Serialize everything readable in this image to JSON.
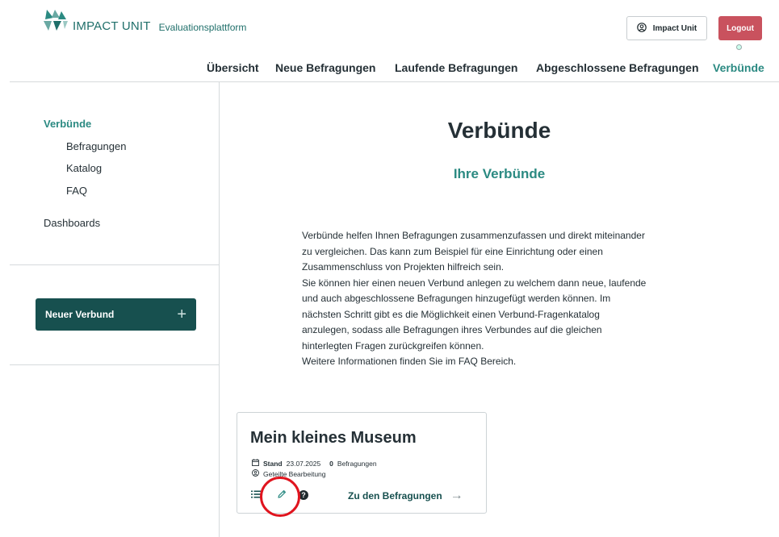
{
  "header": {
    "logo_brand": "IMPACT UNIT",
    "logo_sub": "Evaluationsplattform",
    "user_button": "Impact Unit",
    "logout_button": "Logout"
  },
  "nav": {
    "items": [
      "Übersicht",
      "Neue Befragungen",
      "Laufende Befragungen",
      "Abgeschlossene Befragungen",
      "Verbünde"
    ],
    "active": "Verbünde"
  },
  "sidebar": {
    "section": "Verbünde",
    "items": [
      "Befragungen",
      "Katalog",
      "FAQ"
    ],
    "dashboards": "Dashboards",
    "new_button": "Neuer Verbund",
    "new_button_icon": "plus-icon"
  },
  "main": {
    "title": "Verbünde",
    "subtitle": "Ihre Verbünde",
    "description_lines": [
      "Verbünde helfen Ihnen Befragungen zusammenzufassen und direkt miteinander",
      "zu vergleichen. Das kann zum Beispiel für eine Einrichtung oder einen",
      "Zusammenschluss von Projekten hilfreich sein.",
      "Sie können hier einen neuen Verbund anlegen zu welchem dann neue, laufende",
      "und auch abgeschlossene Befragungen hinzugefügt werden können. Im",
      "nächsten Schritt gibt es die Möglichkeit einen Verbund-Fragenkatalog",
      "anzulegen, sodass alle Befragungen ihres Verbundes auf die gleichen",
      "hinterlegten Fragen zurückgreifen können.",
      "Weitere Informationen finden Sie im FAQ Bereich."
    ]
  },
  "card": {
    "title": "Mein kleines Museum",
    "stand_label": "Stand",
    "stand_date": "23.07.2025",
    "count": "0",
    "count_label": "Befragungen",
    "shared": "Geteilte Bearbeitung",
    "link": "Zu den Befragungen",
    "help_glyph": "?",
    "arrow": "→"
  },
  "colors": {
    "accent": "#2b8a82",
    "dark_teal": "#17504f",
    "logout": "#c9525e",
    "highlight": "#e0141e"
  }
}
